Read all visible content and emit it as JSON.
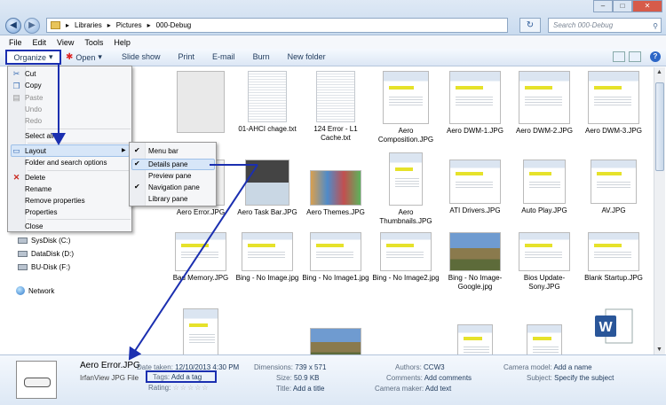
{
  "address": {
    "crumbs": [
      "Libraries",
      "Pictures",
      "000-Debug"
    ],
    "search_placeholder": "Search 000-Debug"
  },
  "menubar": [
    "File",
    "Edit",
    "View",
    "Tools",
    "Help"
  ],
  "toolbar": {
    "organize": "Organize",
    "open": "Open",
    "slideshow": "Slide show",
    "print": "Print",
    "email": "E-mail",
    "burn": "Burn",
    "new_folder": "New folder"
  },
  "organize_menu": {
    "cut": "Cut",
    "copy": "Copy",
    "paste": "Paste",
    "undo": "Undo",
    "redo": "Redo",
    "select_all": "Select all",
    "layout": "Layout",
    "folder_options": "Folder and search options",
    "delete": "Delete",
    "rename": "Rename",
    "remove_properties": "Remove properties",
    "properties": "Properties",
    "close": "Close"
  },
  "layout_submenu": {
    "menu_bar": "Menu bar",
    "details_pane": "Details pane",
    "preview_pane": "Preview pane",
    "navigation_pane": "Navigation pane",
    "library_pane": "Library pane"
  },
  "nav": {
    "drives": [
      "SysDisk (C:)",
      "DataDisk (D:)",
      "BU-Disk (F:)"
    ],
    "network": "Network"
  },
  "files": [
    {
      "name": "01-AHCI chage.txt"
    },
    {
      "name": "124 Error - L1 Cache.txt"
    },
    {
      "name": "Aero Composition.JPG"
    },
    {
      "name": "Aero DWM-1.JPG"
    },
    {
      "name": "Aero DWM-2.JPG"
    },
    {
      "name": "Aero DWM-3.JPG"
    },
    {
      "name": "Aero Error.JPG"
    },
    {
      "name": "Aero Task Bar.JPG"
    },
    {
      "name": "Aero Themes.JPG"
    },
    {
      "name": "Aero Thumbnails.JPG"
    },
    {
      "name": "ATI Drivers.JPG"
    },
    {
      "name": "Auto Play.JPG"
    },
    {
      "name": "AV.JPG"
    },
    {
      "name": "Bad Memory.JPG"
    },
    {
      "name": "Bing - No Image.jpg"
    },
    {
      "name": "Bing - No Image1.jpg"
    },
    {
      "name": "Bing - No Image2.jpg"
    },
    {
      "name": "Bing - No Image-Google.jpg"
    },
    {
      "name": "Bios Update-Sony.JPG"
    },
    {
      "name": "Blank Startup.JPG"
    }
  ],
  "details": {
    "filename": "Aero Error.JPG",
    "filetype": "IrfanView JPG File",
    "date_taken_label": "Date taken:",
    "date_taken_value": "12/10/2013 4:30 PM",
    "tags_label": "Tags:",
    "tags_value": "Add a tag",
    "rating_label": "Rating:",
    "rating_stars": "☆☆☆☆☆",
    "dimensions_label": "Dimensions:",
    "dimensions_value": "739 x 571",
    "size_label": "Size:",
    "size_value": "50.9 KB",
    "title_label": "Title:",
    "title_value": "Add a title",
    "authors_label": "Authors:",
    "authors_value": "CCW3",
    "comments_label": "Comments:",
    "comments_value": "Add comments",
    "camera_maker_label": "Camera maker:",
    "camera_maker_value": "Add text",
    "camera_model_label": "Camera model:",
    "camera_model_value": "Add a name",
    "subject_label": "Subject:",
    "subject_value": "Specify the subject"
  },
  "colors": {
    "annotation": "#1b2fb0",
    "highlight": "#d7e6f8"
  }
}
